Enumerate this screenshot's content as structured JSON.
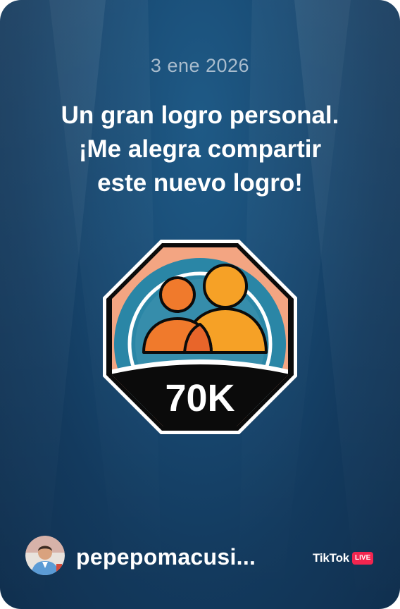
{
  "card": {
    "date": "3 ene 2026",
    "headline_line1": "Un gran logro personal.",
    "headline_line2": "¡Me alegra compartir",
    "headline_line3": "este nuevo logro!"
  },
  "badge": {
    "icon": "two-people-icon",
    "milestone_label": "70K"
  },
  "footer": {
    "username": "pepepomacusi...",
    "brand": "TikTok",
    "live_label": "LIVE"
  },
  "colors": {
    "background": "#184a73",
    "badge_black": "#0b0b0b",
    "badge_peach": "#f3a582",
    "badge_teal": "#2a86a6",
    "person_front": "#f07a2c",
    "person_back": "#f6a126",
    "live_red": "#f2254f"
  }
}
